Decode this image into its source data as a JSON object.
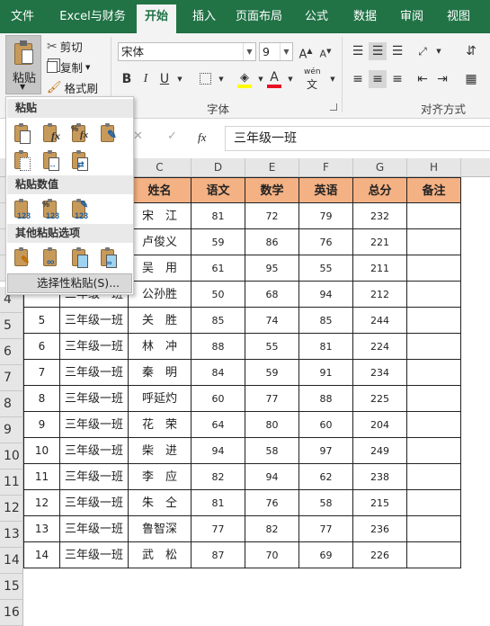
{
  "tabs": [
    {
      "label": "文件",
      "active": false
    },
    {
      "label": "Excel与财务",
      "active": false
    },
    {
      "label": "开始",
      "active": true
    },
    {
      "label": "插入",
      "active": false
    },
    {
      "label": "页面布局",
      "active": false
    },
    {
      "label": "公式",
      "active": false
    },
    {
      "label": "数据",
      "active": false
    },
    {
      "label": "审阅",
      "active": false
    },
    {
      "label": "视图",
      "active": false
    }
  ],
  "ribbon": {
    "paste_label": "粘贴",
    "cut_label": "剪切",
    "copy_label": "复制",
    "format_painter_label": "格式刷",
    "font_name": "宋体",
    "font_size": "9",
    "bold": "B",
    "italic": "I",
    "underline": "U",
    "font_group_label": "字体",
    "align_group_label": "对齐方式",
    "font_color": "#e81123",
    "fill_color": "#ffff00",
    "phonetic_label": "wén"
  },
  "formula_bar": {
    "fx": "fx",
    "content": "三年级一班",
    "cancel": "✕",
    "enter": "✓"
  },
  "paste_menu": {
    "section_paste": "粘贴",
    "section_values": "粘贴数值",
    "section_other": "其他粘贴选项",
    "special_paste": "选择性粘贴(S)..."
  },
  "columns": [
    "C",
    "D",
    "E",
    "F",
    "G",
    "H"
  ],
  "row_numbers": [
    "4",
    "5",
    "6",
    "7",
    "8",
    "9",
    "10",
    "11",
    "12",
    "13",
    "14",
    "15",
    "16"
  ],
  "header_row": [
    "姓名",
    "语文",
    "数学",
    "英语",
    "总分",
    "备注"
  ],
  "rows": [
    {
      "no": "",
      "cls": "",
      "name": "宋　江",
      "chinese": "81",
      "math": "72",
      "english": "79",
      "total": "232",
      "note": ""
    },
    {
      "no": "",
      "cls": "",
      "name": "卢俊义",
      "chinese": "59",
      "math": "86",
      "english": "76",
      "total": "221",
      "note": ""
    },
    {
      "no": "",
      "cls": "",
      "name": "吴　用",
      "chinese": "61",
      "math": "95",
      "english": "55",
      "total": "211",
      "note": ""
    },
    {
      "no": "",
      "cls": "三年级一班",
      "name": "公孙胜",
      "chinese": "50",
      "math": "68",
      "english": "94",
      "total": "212",
      "note": ""
    },
    {
      "no": "5",
      "cls": "三年级一班",
      "name": "关　胜",
      "chinese": "85",
      "math": "74",
      "english": "85",
      "total": "244",
      "note": ""
    },
    {
      "no": "6",
      "cls": "三年级一班",
      "name": "林　冲",
      "chinese": "88",
      "math": "55",
      "english": "81",
      "total": "224",
      "note": ""
    },
    {
      "no": "7",
      "cls": "三年级一班",
      "name": "秦　明",
      "chinese": "84",
      "math": "59",
      "english": "91",
      "total": "234",
      "note": ""
    },
    {
      "no": "8",
      "cls": "三年级一班",
      "name": "呼延灼",
      "chinese": "60",
      "math": "77",
      "english": "88",
      "total": "225",
      "note": ""
    },
    {
      "no": "9",
      "cls": "三年级一班",
      "name": "花　荣",
      "chinese": "64",
      "math": "80",
      "english": "60",
      "total": "204",
      "note": ""
    },
    {
      "no": "10",
      "cls": "三年级一班",
      "name": "柴　进",
      "chinese": "94",
      "math": "58",
      "english": "97",
      "total": "249",
      "note": ""
    },
    {
      "no": "11",
      "cls": "三年级一班",
      "name": "李　应",
      "chinese": "82",
      "math": "94",
      "english": "62",
      "total": "238",
      "note": ""
    },
    {
      "no": "12",
      "cls": "三年级一班",
      "name": "朱　仝",
      "chinese": "81",
      "math": "76",
      "english": "58",
      "total": "215",
      "note": ""
    },
    {
      "no": "13",
      "cls": "三年级一班",
      "name": "鲁智深",
      "chinese": "77",
      "math": "82",
      "english": "77",
      "total": "236",
      "note": ""
    },
    {
      "no": "14",
      "cls": "三年级一班",
      "name": "武　松",
      "chinese": "87",
      "math": "70",
      "english": "69",
      "total": "226",
      "note": ""
    }
  ],
  "colors": {
    "accent": "#217346",
    "header_fill": "#f4b183"
  }
}
